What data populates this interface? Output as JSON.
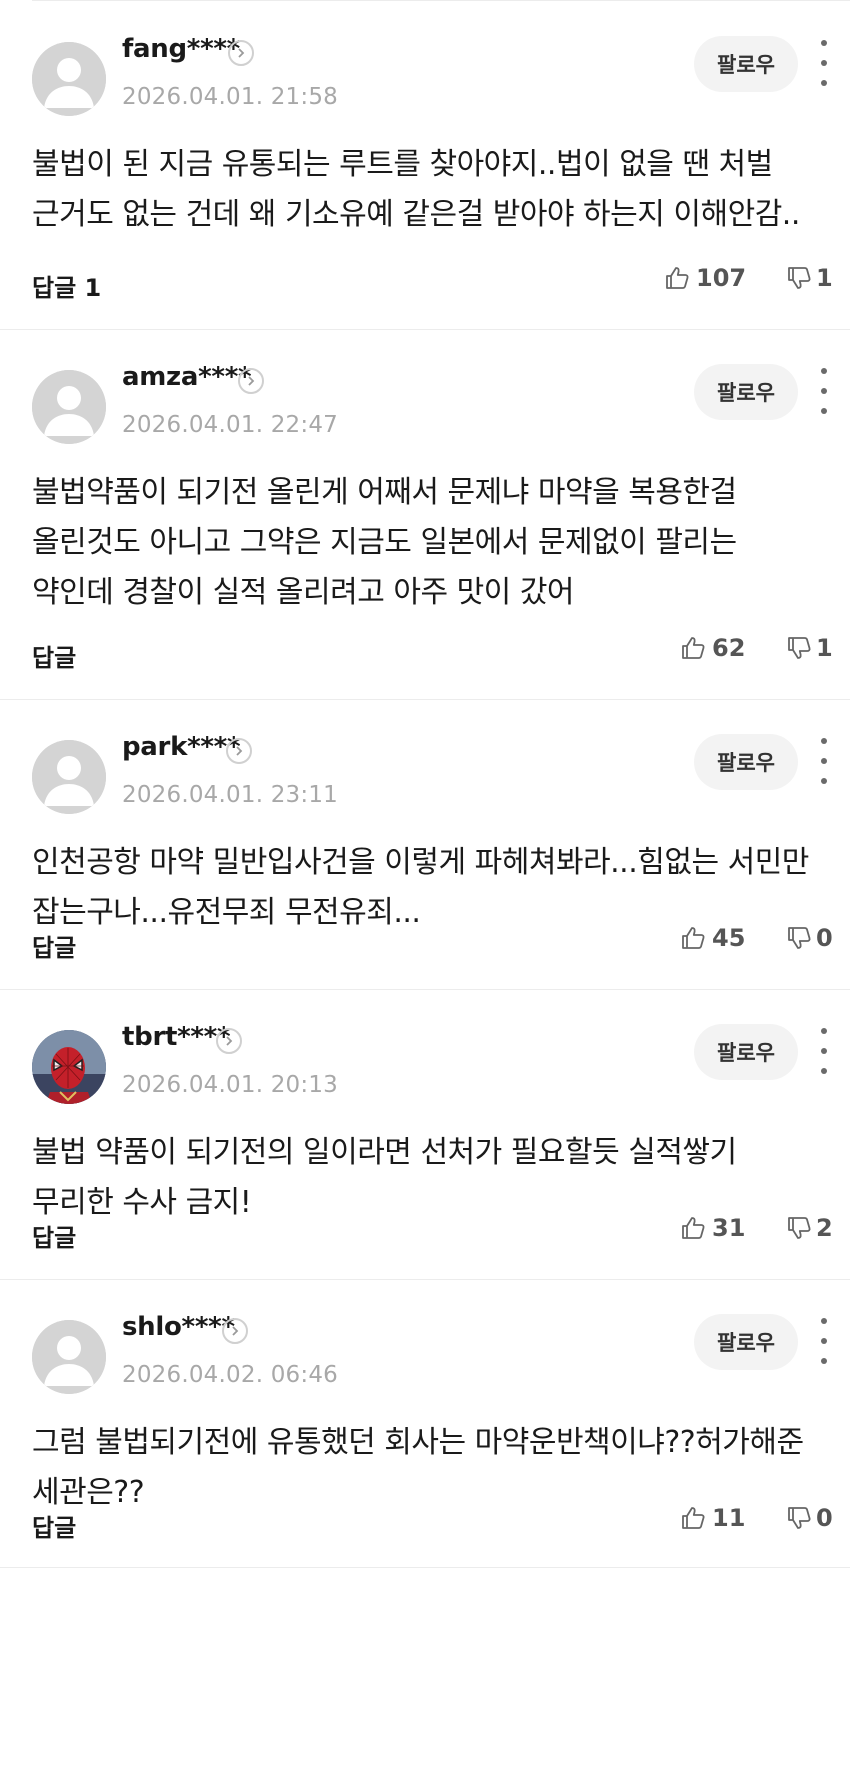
{
  "comments": [
    {
      "author": "fang****",
      "date": "2026.04.01. 21:58",
      "follow_label": "팔로우",
      "body": "불법이 된 지금 유통되는 루트를 찾아야지..법이 없을 땐 처벌 근거도 없는 건데 왜 기소유예 같은걸 받아야 하는지 이해안감..",
      "reply_label": "답글 1",
      "likes": "107",
      "dislikes": "1",
      "avatar": "default-avatar-icon"
    },
    {
      "author": "amza****",
      "date": "2026.04.01. 22:47",
      "follow_label": "팔로우",
      "body": "불법약품이 되기전 올린게 어째서 문제냐 마약을 복용한걸 올린것도 아니고 그약은 지금도 일본에서 문제없이 팔리는 약인데 경찰이 실적 올리려고 아주 맛이 갔어",
      "reply_label": "답글",
      "likes": "62",
      "dislikes": "1",
      "avatar": "default-avatar-icon"
    },
    {
      "author": "park****",
      "date": "2026.04.01. 23:11",
      "follow_label": "팔로우",
      "body": "인천공항 마약 밀반입사건을 이렇게 파헤쳐봐라...힘없는 서민만 잡는구나...유전무죄 무전유죄...",
      "reply_label": "답글",
      "likes": "45",
      "dislikes": "0",
      "avatar": "default-avatar-icon"
    },
    {
      "author": "tbrt****",
      "date": "2026.04.01. 20:13",
      "follow_label": "팔로우",
      "body": "불법 약품이 되기전의 일이라면 선처가 필요할듯 실적쌓기 무리한 수사 금지!",
      "reply_label": "답글",
      "likes": "31",
      "dislikes": "2",
      "avatar": "profile-photo-avatar"
    },
    {
      "author": "shlo****",
      "date": "2026.04.02. 06:46",
      "follow_label": "팔로우",
      "body": "그럼 불법되기전에 유통했던 회사는 마약운반책이냐??허가해준 세관은??",
      "reply_label": "답글",
      "likes": "11",
      "dislikes": "0",
      "avatar": "default-avatar-icon"
    }
  ]
}
